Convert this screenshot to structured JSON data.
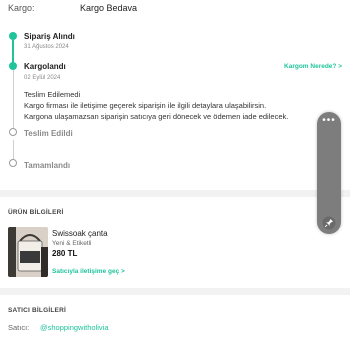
{
  "cargo": {
    "label": "Kargo:",
    "value": "Kargo Bedava"
  },
  "timeline": {
    "steps": [
      {
        "title": "Sipariş Alındı",
        "date": "31 Ağustos 2024"
      },
      {
        "title": "Kargolandı",
        "date": "02 Eylül 2024",
        "link": "Kargom Nerede? >"
      },
      {
        "title": "Teslim Edildi"
      },
      {
        "title": "Tamamlandı"
      }
    ],
    "message": {
      "title": "Teslim Edilemedi",
      "line1": "Kargo firması ile iletişime geçerek siparişin ile ilgili detaylara ulaşabilirsin.",
      "line2": "Kargona ulaşamazsan siparişin satıcıya geri dönecek ve ödemen iade edilecek."
    }
  },
  "product_info": {
    "heading": "ÜRÜN BİLGİLERİ",
    "name": "Swissoak çanta",
    "condition": "Yeni & Etiketli",
    "price": "280 TL",
    "contact_link": "Satıcıyla iletişime geç >"
  },
  "seller_info": {
    "heading": "SATICI BİLGİLERİ",
    "label": "Satıcı:",
    "value": "@shoppingwitholivia"
  },
  "colors": {
    "accent": "#1fc49b",
    "divider": "#f2f2f2",
    "toolbar": "#7d7d7d"
  },
  "toolbar": {
    "menu_icon": "more-dots-icon",
    "pin_icon": "pin-icon"
  }
}
